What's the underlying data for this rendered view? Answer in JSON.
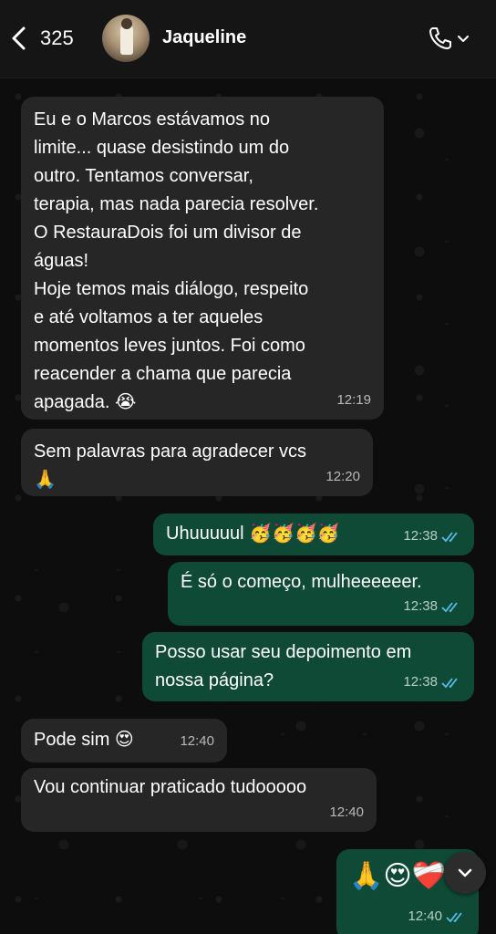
{
  "header": {
    "back_count": "325",
    "contact_name": "Jaqueline"
  },
  "messages": [
    {
      "direction": "in",
      "text": "Eu e o Marcos estávamos no\nlimite... quase desistindo um do\noutro. Tentamos conversar,\nterapia, mas nada parecia resolver.\nO RestauraDois foi um divisor de\náguas!\nHoje temos mais diálogo, respeito\ne até voltamos a ter aqueles\nmomentos leves juntos. Foi como\nreacender a chama que parecia\napagada. 😭",
      "time": "12:19"
    },
    {
      "direction": "in",
      "text": "Sem palavras para agradecer vcs\n🙏",
      "time": "12:20"
    },
    {
      "direction": "out",
      "text": "Uhuuuuul 🥳🥳🥳🥳",
      "time": "12:38",
      "status": "read"
    },
    {
      "direction": "out",
      "text": "É só o começo, mulheeeeeer.",
      "time": "12:38",
      "status": "read"
    },
    {
      "direction": "out",
      "text": "Posso usar seu depoimento em\nnossa página?",
      "time": "12:38",
      "status": "read"
    },
    {
      "direction": "in",
      "text": "Pode sim 😍",
      "time": "12:40"
    },
    {
      "direction": "in",
      "text": "Vou continuar praticado tudooooo",
      "time": "12:40"
    },
    {
      "direction": "out",
      "text": "🙏😍❤️‍🩹",
      "time": "12:40",
      "status": "read"
    }
  ],
  "icons": {
    "back": "chevron-left-icon",
    "call": "phone-icon",
    "dropdown": "chevron-down-icon",
    "read_receipt": "double-check-icon",
    "scroll_down": "chevron-down-icon"
  },
  "colors": {
    "incoming_bubble": "#262626",
    "outgoing_bubble": "#0f4a36",
    "read_tick": "#53bdeb"
  }
}
